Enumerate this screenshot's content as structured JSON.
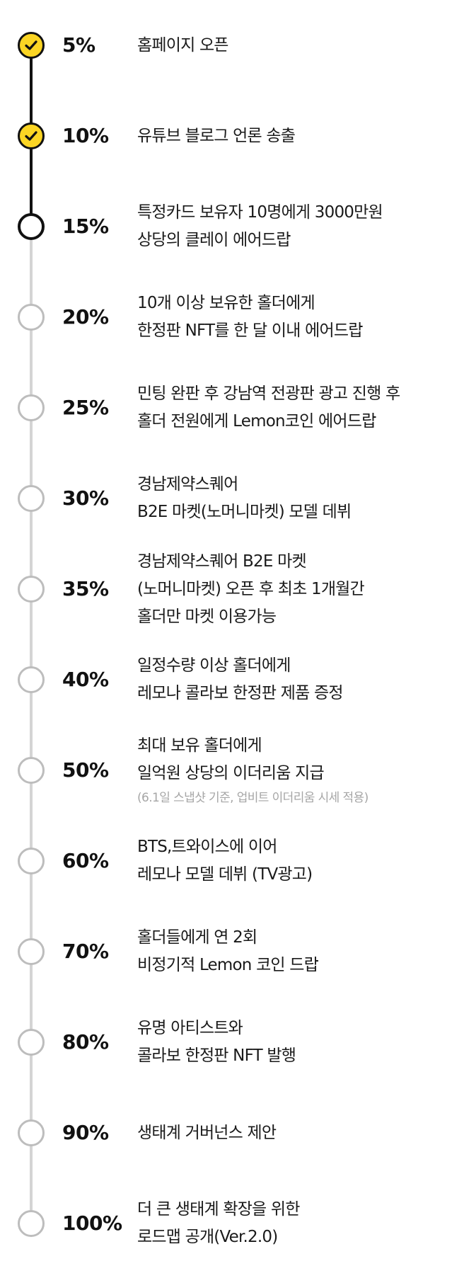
{
  "colors": {
    "accent": "#fbd524",
    "active_line": "#111111",
    "inactive_line": "#d4d4d4",
    "inactive_circle": "#bdbdbd",
    "note_text": "#a6a6a6"
  },
  "milestones": [
    {
      "percent": "5%",
      "status": "done",
      "icon": "check-icon",
      "lines": [
        "홈페이지 오픈"
      ]
    },
    {
      "percent": "10%",
      "status": "done",
      "icon": "check-icon",
      "lines": [
        "유튜브 블로그 언론 송출"
      ]
    },
    {
      "percent": "15%",
      "status": "current",
      "icon": "open-circle-icon",
      "lines": [
        "특정카드 보유자 10명에게 3000만원",
        "상당의 클레이 에어드랍"
      ]
    },
    {
      "percent": "20%",
      "status": "todo",
      "icon": "open-circle-icon",
      "lines": [
        "10개 이상 보유한 홀더에게",
        "한정판 NFT를 한 달 이내 에어드랍"
      ]
    },
    {
      "percent": "25%",
      "status": "todo",
      "icon": "open-circle-icon",
      "lines": [
        "민팅 완판 후 강남역 전광판 광고 진행 후",
        "홀더 전원에게 Lemon코인 에어드랍"
      ]
    },
    {
      "percent": "30%",
      "status": "todo",
      "icon": "open-circle-icon",
      "lines": [
        "경남제약스퀘어",
        "B2E 마켓(노머니마켓) 모델 데뷔"
      ]
    },
    {
      "percent": "35%",
      "status": "todo",
      "icon": "open-circle-icon",
      "lines": [
        "경남제약스퀘어 B2E 마켓",
        "(노머니마켓) 오픈 후 최초 1개월간",
        "홀더만 마켓 이용가능"
      ]
    },
    {
      "percent": "40%",
      "status": "todo",
      "icon": "open-circle-icon",
      "lines": [
        "일정수량 이상 홀더에게",
        "레모나 콜라보 한정판 제품 증정"
      ]
    },
    {
      "percent": "50%",
      "status": "todo",
      "icon": "open-circle-icon",
      "lines": [
        "최대 보유 홀더에게",
        "일억원 상당의 이더리움 지급"
      ],
      "note": "(6.1일 스냅샷 기준, 업비트 이더리움 시세 적용)"
    },
    {
      "percent": "60%",
      "status": "todo",
      "icon": "open-circle-icon",
      "lines": [
        "BTS,트와이스에 이어",
        "레모나 모델 데뷔 (TV광고)"
      ]
    },
    {
      "percent": "70%",
      "status": "todo",
      "icon": "open-circle-icon",
      "lines": [
        "홀더들에게 연 2회",
        "비정기적 Lemon 코인 드랍"
      ]
    },
    {
      "percent": "80%",
      "status": "todo",
      "icon": "open-circle-icon",
      "lines": [
        "유명 아티스트와",
        "콜라보 한정판 NFT 발행"
      ]
    },
    {
      "percent": "90%",
      "status": "todo",
      "icon": "open-circle-icon",
      "lines": [
        "생태계 거버넌스 제안"
      ]
    },
    {
      "percent": "100%",
      "status": "todo",
      "icon": "open-circle-icon",
      "lines": [
        "더 큰 생태계 확장을 위한",
        "로드맵 공개(Ver.2.0)"
      ]
    }
  ]
}
